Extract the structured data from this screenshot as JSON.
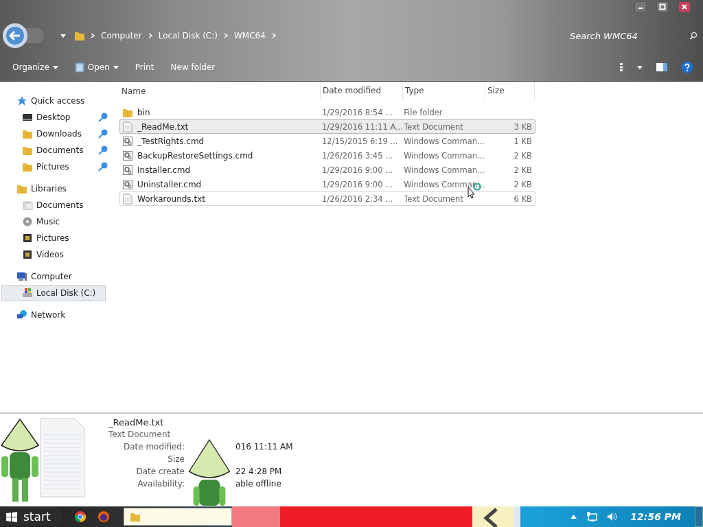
{
  "address": {
    "crumbs": [
      "Computer",
      "Local Disk (C:)",
      "WMC64"
    ]
  },
  "search": {
    "placeholder": "Search WMC64"
  },
  "toolbar": {
    "buttons": [
      {
        "label": "Organize",
        "kind": "menu"
      },
      {
        "label": "Open",
        "kind": "open"
      },
      {
        "label": "Print",
        "kind": "plain"
      },
      {
        "label": "New folder",
        "kind": "plain"
      }
    ]
  },
  "sidebar": {
    "groups": [
      {
        "label": "Quick access",
        "kind": "star",
        "selected": false,
        "children": [
          {
            "label": "Desktop",
            "kind": "desktop",
            "pinned": true,
            "selected": false
          },
          {
            "label": "Downloads",
            "kind": "folder",
            "pinned": true,
            "selected": false
          },
          {
            "label": "Documents",
            "kind": "folder",
            "pinned": true,
            "selected": false
          },
          {
            "label": "Pictures",
            "kind": "folder",
            "pinned": true,
            "selected": false
          }
        ]
      },
      {
        "label": "Libraries",
        "kind": "folder",
        "selected": false,
        "children": [
          {
            "label": "Documents",
            "kind": "docs",
            "pinned": false,
            "selected": false
          },
          {
            "label": "Music",
            "kind": "music",
            "pinned": false,
            "selected": false
          },
          {
            "label": "Pictures",
            "kind": "film",
            "pinned": false,
            "selected": false
          },
          {
            "label": "Videos",
            "kind": "film",
            "pinned": false,
            "selected": false
          }
        ]
      },
      {
        "label": "Computer",
        "kind": "computer",
        "selected": false,
        "children": [
          {
            "label": "Local Disk (C:)",
            "kind": "drive",
            "pinned": false,
            "selected": true
          }
        ]
      },
      {
        "label": "Network",
        "kind": "network",
        "selected": false
      }
    ]
  },
  "table": {
    "columns": [
      "Name",
      "Date modified",
      "Type",
      "Size"
    ],
    "rows": [
      {
        "name": "bin",
        "date": "1/29/2016 8:54 ...",
        "type": "File folder",
        "size": "",
        "kind": "folder",
        "selected": false,
        "hover": false
      },
      {
        "name": "_ReadMe.txt",
        "date": "1/29/2016 11:11 A...",
        "type": "Text Document",
        "size": "3 KB",
        "kind": "text",
        "selected": true,
        "hover": false
      },
      {
        "name": "_TestRights.cmd",
        "date": "12/15/2015 6:19 ...",
        "type": "Windows Comman...",
        "size": "1 KB",
        "kind": "cmd",
        "selected": false,
        "hover": false
      },
      {
        "name": "BackupRestoreSettings.cmd",
        "date": "1/26/2016 3:45 ...",
        "type": "Windows Comman...",
        "size": "2 KB",
        "kind": "cmd",
        "selected": false,
        "hover": false
      },
      {
        "name": "Installer.cmd",
        "date": "1/29/2016 9:00 ...",
        "type": "Windows Comman...",
        "size": "2 KB",
        "kind": "cmd",
        "selected": false,
        "hover": false
      },
      {
        "name": "Uninstaller.cmd",
        "date": "1/29/2016 9:00 ...",
        "type": "Windows Comman...",
        "size": "2 KB",
        "kind": "cmd",
        "selected": false,
        "hover": false
      },
      {
        "name": "Workarounds.txt",
        "date": "1/26/2016 2:34 ...",
        "type": "Text Document",
        "size": "6 KB",
        "kind": "text",
        "selected": false,
        "hover": true
      }
    ]
  },
  "details": {
    "name": "_ReadMe.txt",
    "type": "Text Document",
    "fields": [
      {
        "label": "Date modified:",
        "value": "016 11:11 AM"
      },
      {
        "label": "Size"
      },
      {
        "label": "Date create",
        "value": "22 4:28 PM"
      },
      {
        "label": "Availability:",
        "value": "able offline"
      }
    ]
  },
  "taskbar": {
    "start": "start",
    "clock": "12:56 PM"
  }
}
